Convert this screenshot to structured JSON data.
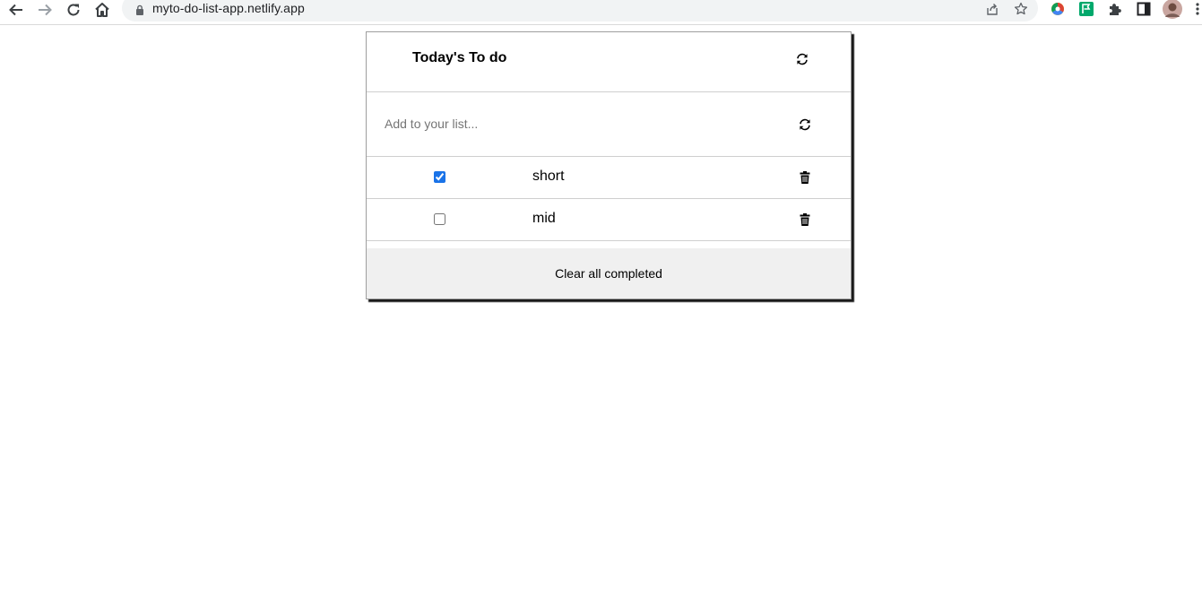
{
  "browser": {
    "url": "myto-do-list-app.netlify.app",
    "icons": {
      "back": "back-arrow-icon",
      "forward": "forward-arrow-icon",
      "reload": "reload-icon",
      "home": "home-icon",
      "lock": "lock-icon",
      "share": "share-icon",
      "bookmark": "star-icon"
    },
    "extensions": [
      "colorful-extension-icon",
      "green-flag-extension-icon",
      "puzzle-extensions-icon",
      "side-panel-icon",
      "profile-avatar"
    ]
  },
  "todo": {
    "title": "Today's To do",
    "input_placeholder": "Add to your list...",
    "input_value": "",
    "items": [
      {
        "label": "short",
        "completed": true
      },
      {
        "label": "mid",
        "completed": false
      }
    ],
    "clear_label": "Clear all completed"
  },
  "colors": {
    "checkbox_accent": "#1a73e8",
    "clear_bg": "#f0f0f0",
    "omnibox_bg": "#f1f3f4"
  }
}
